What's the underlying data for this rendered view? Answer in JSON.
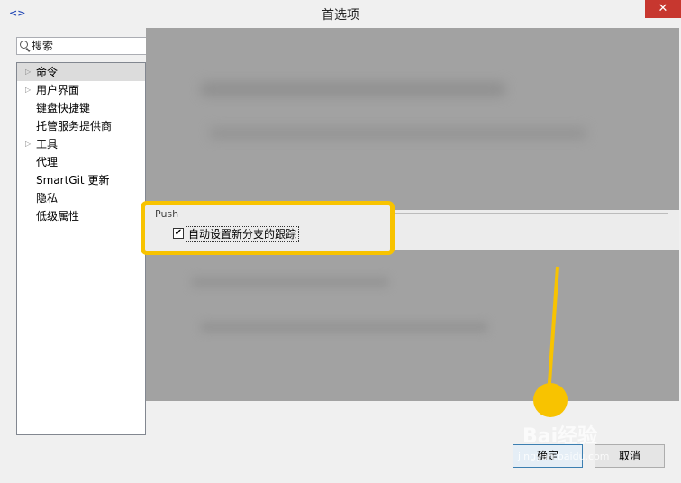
{
  "window": {
    "title": "首选项",
    "app_icon": "<>",
    "close_glyph": "✕"
  },
  "search": {
    "placeholder": "搜索",
    "value": ""
  },
  "tree": [
    {
      "label": "命令",
      "expandable": true,
      "selected": true
    },
    {
      "label": "用户界面",
      "expandable": true,
      "selected": false
    },
    {
      "label": "键盘快捷键",
      "expandable": false,
      "selected": false
    },
    {
      "label": "托管服务提供商",
      "expandable": false,
      "selected": false
    },
    {
      "label": "工具",
      "expandable": true,
      "selected": false
    },
    {
      "label": "代理",
      "expandable": false,
      "selected": false
    },
    {
      "label": "SmartGit 更新",
      "expandable": false,
      "selected": false
    },
    {
      "label": "隐私",
      "expandable": false,
      "selected": false
    },
    {
      "label": "低级属性",
      "expandable": false,
      "selected": false
    }
  ],
  "push": {
    "group_label": "Push",
    "checkbox_label": "自动设置新分支的跟踪",
    "checked": true
  },
  "buttons": {
    "ok": "确定",
    "cancel": "取消"
  },
  "watermark": {
    "line1": "Bai经验",
    "line2": "jingyan.baidu.com"
  },
  "colors": {
    "highlight": "#f8c300",
    "close": "#c7372f"
  }
}
